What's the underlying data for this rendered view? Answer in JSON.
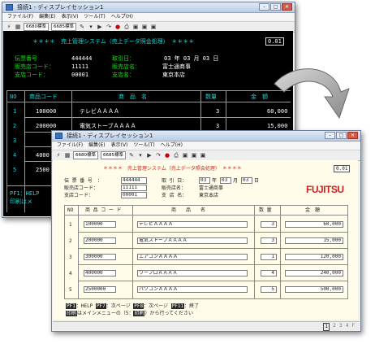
{
  "back_window": {
    "title": "接続1 - ディスプレイセッション1",
    "menu": [
      "ファイル(F)",
      "編集(E)",
      "表示(V)",
      "ツール(T)",
      "ヘルプ(H)"
    ],
    "toolbar_select1": "6680標準",
    "toolbar_select2": "6685標準",
    "screen": {
      "title": "＊＊＊＊　売上管理システム（売上データ照会処理）　＊＊＊＊",
      "screen_id": "0.01",
      "invoice_label": "伝票番号",
      "invoice_value": "444444",
      "date_label": "取引日：",
      "date_value": "03 年 03 月 03 日",
      "seller_code_label": "販売店コード：",
      "seller_code_value": "11111",
      "seller_name_label": "販売店名：",
      "seller_name_value": "富士通商事",
      "branch_code_label": "支店コード：",
      "branch_code_value": "00001",
      "branch_name_label": "支店名：",
      "branch_name_value": "東京本店",
      "col_no": "NO",
      "col_code": "商品コード",
      "col_name": "商　品　名",
      "col_qty": "数量",
      "col_amount": "金　額",
      "rows": [
        {
          "no": "1",
          "code": "100000",
          "name": "テレビＡＡＡＡ",
          "qty": "3",
          "amount": "60,000"
        },
        {
          "no": "2",
          "code": "200000",
          "name": "電気ストーブＡＡＡＡ",
          "qty": "3",
          "amount": "15,000"
        },
        {
          "no": "3",
          "code": "",
          "name": "",
          "qty": "",
          "amount": ""
        },
        {
          "no": "4",
          "code": "4000",
          "name": "",
          "qty": "",
          "amount": ""
        },
        {
          "no": "5",
          "code": "2500",
          "name": "",
          "qty": "",
          "amount": ""
        }
      ],
      "pf_line1": "PF1：HELP",
      "pf_line2": "印刷はメ"
    }
  },
  "front_window": {
    "title": "接続1 - ディスプレイセッション1",
    "menu": [
      "ファイル(F)",
      "編集(E)",
      "表示(V)",
      "ツール(T)",
      "ヘルプ(H)"
    ],
    "toolbar_select1": "6680標準",
    "toolbar_select2": "6685標準",
    "logo": "FUJITSU",
    "screen": {
      "title": "＊＊＊＊　売上管理システム（売上データ照会処理）　＊＊＊＊",
      "screen_id": "0.01",
      "invoice_label": "伝 票 番 号　：",
      "invoice_value": "444444",
      "date_label": "取 引 日：",
      "date_year": "03",
      "date_year_unit": "年",
      "date_month": "03",
      "date_month_unit": "月",
      "date_day": "03",
      "date_day_unit": "日",
      "seller_code_label": "販売店コード：",
      "seller_code_value": "11111",
      "seller_name_label": "販売店名：",
      "seller_name_value": "富士通商事",
      "branch_code_label": "支店コード：",
      "branch_code_value": "00001",
      "branch_name_label": "支 店 名：",
      "branch_name_value": "東京本店",
      "col_no": "NO",
      "col_code": "商 品 コ ー ド",
      "col_name": "商　　品　　名",
      "col_qty": "数 量",
      "col_amount": "金　額",
      "rows": [
        {
          "no": "1",
          "code": "100000",
          "name": "テレビＡＡＡＡ",
          "qty": "3",
          "amount": "60,000"
        },
        {
          "no": "2",
          "code": "200000",
          "name": "電気ストーブＡＡＡＡ",
          "qty": "3",
          "amount": "15,000"
        },
        {
          "no": "3",
          "code": "300000",
          "name": "エアコンＡＡＡＡ",
          "qty": "1",
          "amount": "120,000"
        },
        {
          "no": "4",
          "code": "400000",
          "name": "ワープロＡＡＡＡ",
          "qty": "4",
          "amount": "240,000"
        },
        {
          "no": "5",
          "code": "2500000",
          "name": "パソコンＡＡＡＡ",
          "qty": "5",
          "amount": "500,000"
        }
      ],
      "pf1_key": "PF1",
      "pf1_text": "：HELP",
      "pf7_key": "PF7",
      "pf7_text": "：次ページ",
      "pf8_key": "PF8",
      "pf8_text": "：次ページ",
      "pf11_key": "PF11",
      "pf11_text": "：終了",
      "print_key": "印刷",
      "print_text": "はメインメニューの（5：",
      "print_key2": "印刷",
      "print_text2": "）から行ってください"
    },
    "status_pages": [
      "1",
      "2",
      "3",
      "4",
      "F"
    ]
  }
}
